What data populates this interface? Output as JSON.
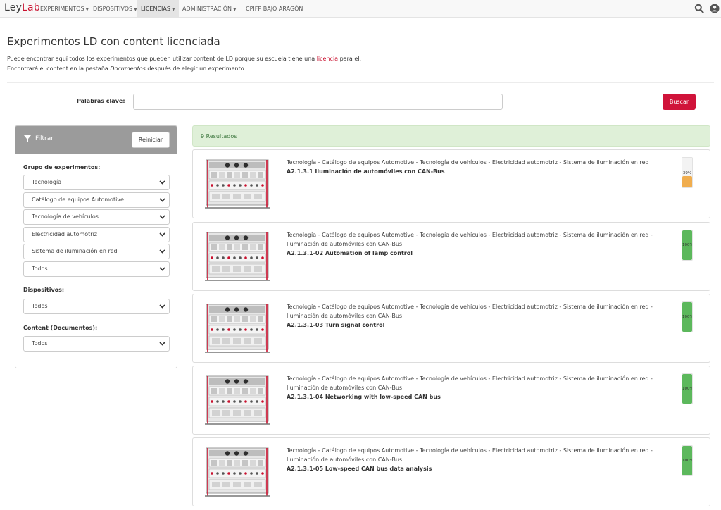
{
  "nav": {
    "logo_a": "Ley",
    "logo_b": "Lab",
    "items": [
      "EXPERIMENTOS",
      "DISPOSITIVOS",
      "LICENCIAS",
      "ADMINISTRACIÓN",
      "CPIFP BAJO ARAGÓN"
    ],
    "active": "LICENCIAS",
    "icons": [
      "search-icon",
      "user-icon"
    ]
  },
  "page": {
    "title": "Experimentos LD con content licenciada",
    "intro_1a": "Puede encontrar aquí todos los experimentos que pueden utilizar content de LD porque su escuela tiene una ",
    "intro_link": "licencia",
    "intro_1b": " para el.",
    "intro_2a": "Encontrará el content en la pestaña ",
    "intro_2em": "Documentos",
    "intro_2b": " después de elegir un experimento."
  },
  "search": {
    "label": "Palabras clave:",
    "value": "",
    "placeholder": "",
    "button": "Buscar"
  },
  "filter": {
    "title": "Filtrar",
    "reset": "Reiniciar",
    "group_label": "Grupo de experimentos:",
    "group_selects": [
      "Tecnología",
      "Catálogo de equipos Automotive",
      "Tecnología de vehículos",
      "Electricidad automotriz",
      "Sistema de iluminación en red",
      "Todos"
    ],
    "devices_label": "Dispositivos:",
    "devices_select": "Todos",
    "content_label": "Content (Documentos):",
    "content_select": "Todos"
  },
  "results": {
    "count": "9 Resultados",
    "items": [
      {
        "path": "Tecnología - Catálogo de equipos Automotive - Tecnología de vehículos - Electricidad automotriz - Sistema de iluminación en red",
        "title": "A2.1.3.1 Iluminación de automóviles con CAN-Bus",
        "progress": 39,
        "progress_label": "39%",
        "color": "#f0ad4e"
      },
      {
        "path": "Tecnología - Catálogo de equipos Automotive - Tecnología de vehículos - Electricidad automotriz - Sistema de iluminación en red - Iluminación de automóviles con CAN-Bus",
        "title": "A2.1.3.1-02 Automation of lamp control",
        "progress": 100,
        "progress_label": "100%",
        "color": "#5cb85c"
      },
      {
        "path": "Tecnología - Catálogo de equipos Automotive - Tecnología de vehículos - Electricidad automotriz - Sistema de iluminación en red - Iluminación de automóviles con CAN-Bus",
        "title": "A2.1.3.1-03 Turn signal control",
        "progress": 100,
        "progress_label": "100%",
        "color": "#5cb85c"
      },
      {
        "path": "Tecnología - Catálogo de equipos Automotive - Tecnología de vehículos - Electricidad automotriz - Sistema de iluminación en red - Iluminación de automóviles con CAN-Bus",
        "title": "A2.1.3.1-04 Networking with low-speed CAN bus",
        "progress": 100,
        "progress_label": "100%",
        "color": "#5cb85c"
      },
      {
        "path": "Tecnología - Catálogo de equipos Automotive - Tecnología de vehículos - Electricidad automotriz - Sistema de iluminación en red - Iluminación de automóviles con CAN-Bus",
        "title": "A2.1.3.1-05 Low-speed CAN bus data analysis",
        "progress": 100,
        "progress_label": "100%",
        "color": "#5cb85c"
      }
    ]
  }
}
